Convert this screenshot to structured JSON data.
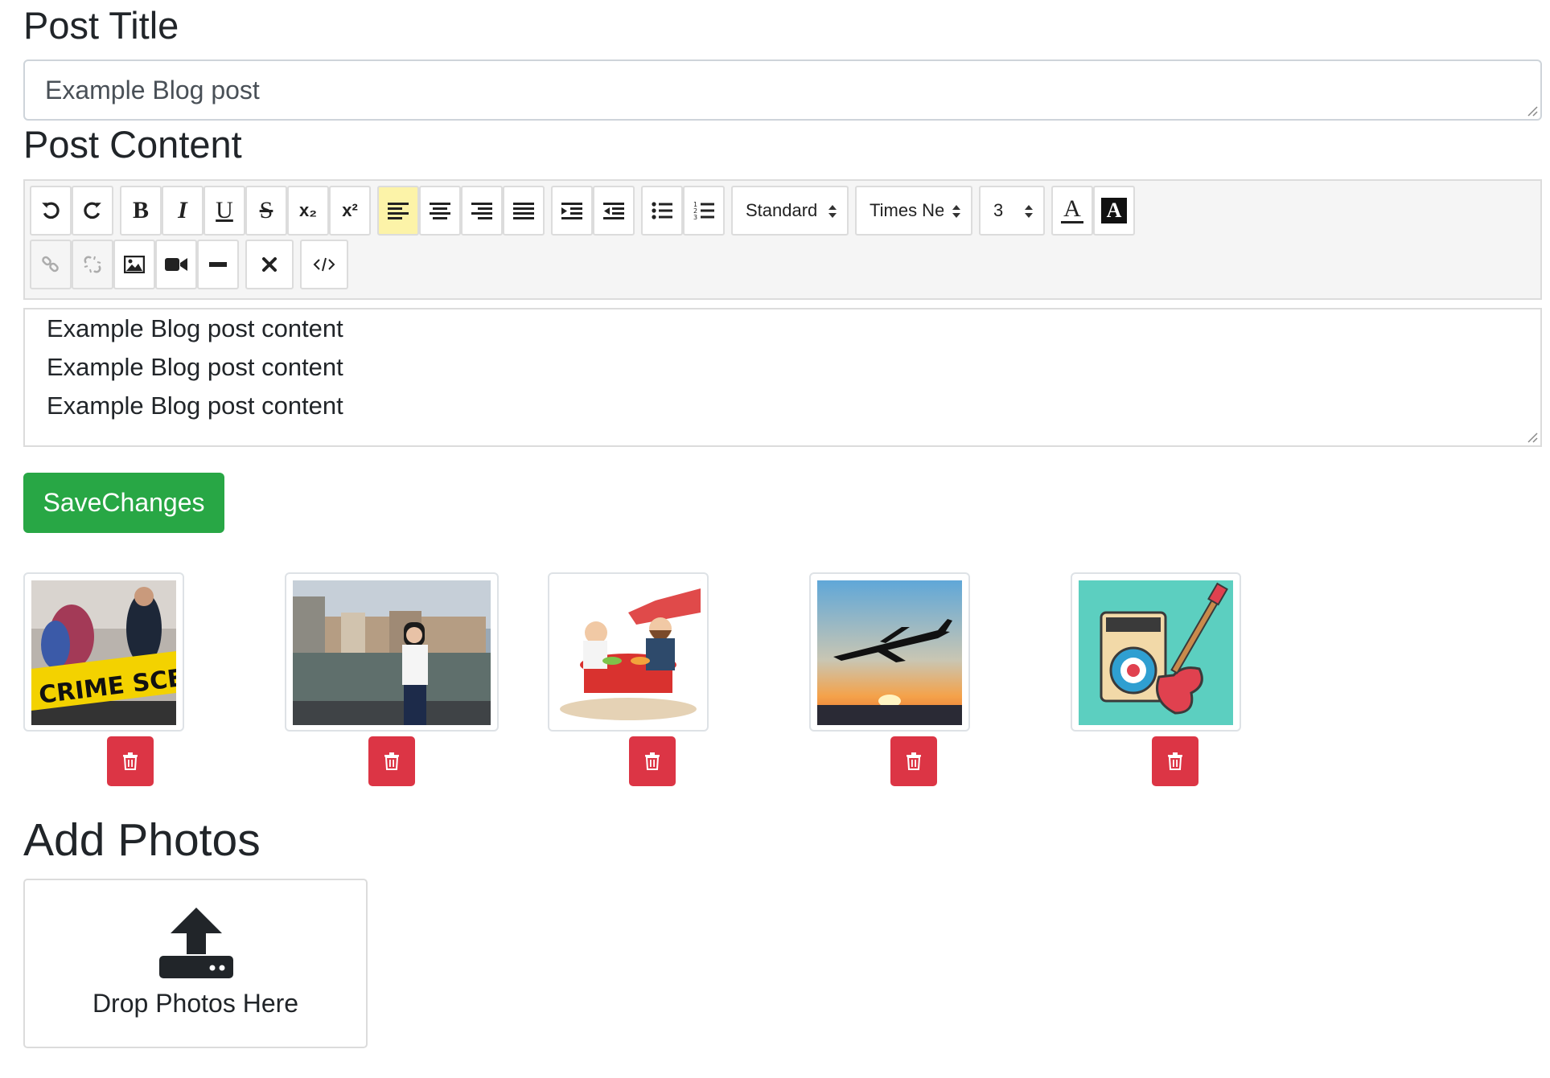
{
  "post_title": {
    "heading": "Post Title",
    "value": "Example Blog post"
  },
  "post_content": {
    "heading": "Post Content",
    "lines": [
      "Example Blog post content",
      "Example Blog post content",
      "Example Blog post content"
    ]
  },
  "toolbar": {
    "row1": [
      {
        "name": "undo-icon"
      },
      {
        "name": "redo-icon"
      },
      {
        "name": "bold-icon",
        "glyph": "B"
      },
      {
        "name": "italic-icon",
        "glyph": "I"
      },
      {
        "name": "underline-icon",
        "glyph": "U"
      },
      {
        "name": "strikethrough-icon",
        "glyph": "S"
      },
      {
        "name": "subscript-icon",
        "glyph": "x₂"
      },
      {
        "name": "superscript-icon",
        "glyph": "x²"
      },
      {
        "name": "align-left-icon",
        "active": true
      },
      {
        "name": "align-center-icon"
      },
      {
        "name": "align-right-icon"
      },
      {
        "name": "align-justify-icon"
      },
      {
        "name": "indent-icon"
      },
      {
        "name": "outdent-icon"
      },
      {
        "name": "bullet-list-icon"
      },
      {
        "name": "numbered-list-icon"
      }
    ],
    "format_select": "Standard",
    "font_select": "Times New R",
    "size_select": "3",
    "font_color_glyph": "A",
    "highlight_glyph": "A",
    "row2": [
      {
        "name": "link-icon",
        "disabled": true
      },
      {
        "name": "unlink-icon",
        "disabled": true
      },
      {
        "name": "image-icon"
      },
      {
        "name": "video-icon"
      },
      {
        "name": "horizontal-rule-icon"
      },
      {
        "name": "remove-format-icon"
      },
      {
        "name": "code-view-icon"
      }
    ],
    "colors": {
      "active_bg": "#fcf3a8",
      "toolbar_bg": "#f5f5f5"
    }
  },
  "save_button": {
    "label": "SaveChanges",
    "color": "#28a745"
  },
  "photos": [
    {
      "subject": "crime-scene-photo"
    },
    {
      "subject": "woman-by-river-photo"
    },
    {
      "subject": "cafe-couple-illustration"
    },
    {
      "subject": "airplane-sunset-photo"
    },
    {
      "subject": "guitar-amplifier-illustration"
    }
  ],
  "delete_button": {
    "icon": "trash-icon",
    "color": "#dc3545"
  },
  "add_photos": {
    "heading": "Add Photos",
    "drop_label": "Drop Photos Here",
    "icon": "upload-icon"
  }
}
